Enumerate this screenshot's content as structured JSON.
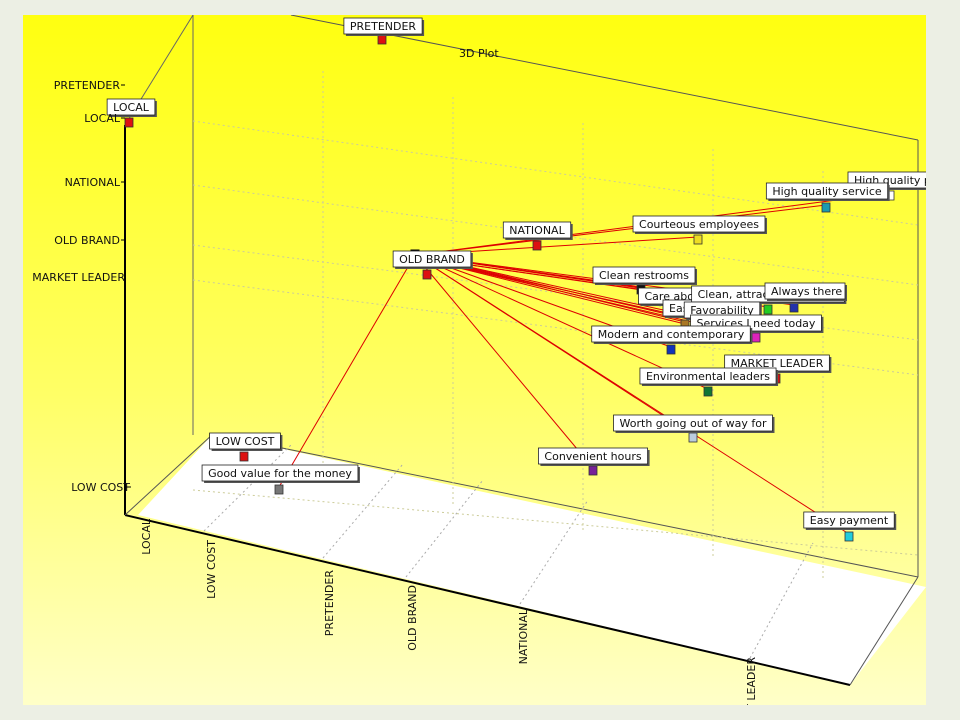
{
  "chart_data": {
    "type": "scatter",
    "title": "3D Plot",
    "axes": {
      "vertical_ticks": [
        "PRETENDER",
        "LOCAL",
        "NATIONAL",
        "OLD BRAND",
        "MARKET LEADER",
        "LOW COST"
      ],
      "floor_ticks": [
        "LOCAL",
        "LOW COST",
        "PRETENDER",
        "OLD BRAND",
        "NATIONAL",
        "MARKET LEADER"
      ]
    },
    "hub": "OLD BRAND",
    "colors": {
      "connector": "#dd0000",
      "background_top": "#ffff10",
      "floor": "#ffffff"
    },
    "points": [
      {
        "label": "PRETENDER",
        "color": "#dd1111",
        "connected": false
      },
      {
        "label": "LOCAL",
        "color": "#dd1111",
        "connected": false
      },
      {
        "label": "NATIONAL",
        "color": "#dd1111",
        "connected": false
      },
      {
        "label": "OLD BRAND",
        "color": "#dd1111",
        "connected": false
      },
      {
        "label": "MARKET LEADER",
        "color": "#dd1111",
        "connected": false
      },
      {
        "label": "LOW COST",
        "color": "#dd1111",
        "connected": false
      },
      {
        "label": "High quality products",
        "color": "#ffffff",
        "connected": true
      },
      {
        "label": "High quality service",
        "color": "#1a9ab0",
        "connected": true
      },
      {
        "label": "Courteous employees",
        "color": "#eedd22",
        "connected": true
      },
      {
        "label": "Clean restrooms",
        "color": "#111111",
        "connected": true
      },
      {
        "label": "Care about community",
        "color": "#8a6a3a",
        "connected": true
      },
      {
        "label": "Easy to shop",
        "color": "#aa7722",
        "connected": true
      },
      {
        "label": "Clean, attractive facilities",
        "color": "#22cc22",
        "connected": true
      },
      {
        "label": "Always there",
        "color": "#2233aa",
        "connected": true
      },
      {
        "label": "Favorability",
        "color": "#55aadd",
        "connected": true
      },
      {
        "label": "Services I need today",
        "color": "#dd22bb",
        "connected": true
      },
      {
        "label": "Modern and contemporary",
        "color": "#1133bb",
        "connected": true
      },
      {
        "label": "Environmental leaders",
        "color": "#117733",
        "connected": true
      },
      {
        "label": "Worth going out of way for",
        "color": "#bbccdd",
        "connected": true
      },
      {
        "label": "Convenient hours",
        "color": "#772299",
        "connected": true
      },
      {
        "label": "Good value for the money",
        "color": "#777777",
        "connected": true
      },
      {
        "label": "Easy payment",
        "color": "#22ccdd",
        "connected": true
      }
    ]
  }
}
